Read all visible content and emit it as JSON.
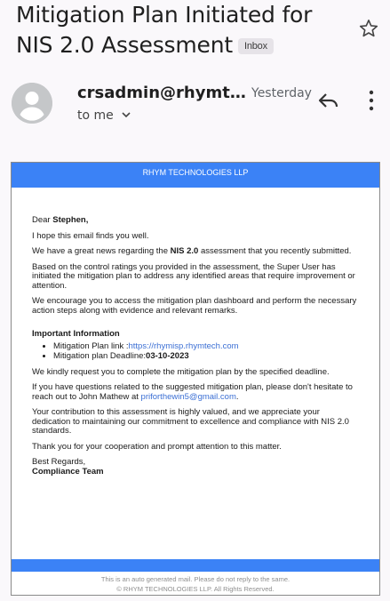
{
  "email": {
    "subject": "Mitigation Plan Initiated for NIS 2.0 Assessment",
    "label": "Inbox",
    "sender": "crsadmin@rhymtec...",
    "date": "Yesterday",
    "recipient": "to me"
  },
  "icons": {
    "star": "star-outline-icon",
    "avatar": "person-icon",
    "reply": "reply-icon",
    "more": "more-vert-icon",
    "expand": "chevron-down-icon"
  },
  "body": {
    "header": "RHYM TECHNOLOGIES LLP",
    "greeting_prefix": "Dear ",
    "greeting_name": "Stephen,",
    "p1": "I hope this email finds you well.",
    "p2_pre": "We have a great news regarding the ",
    "p2_bold": "NIS 2.0",
    "p2_post": " assessment that you recently submitted.",
    "p3": "Based on the control ratings you provided in the assessment, the Super User has initiated the mitigation plan to address any identified areas that require improvement or attention.",
    "p4": "We encourage you to access the mitigation plan dashboard and perform the necessary action steps along with evidence and relevant remarks.",
    "info_title": "Important Information",
    "link_label": "Mitigation Plan link :",
    "link_url": "https://rhymisp.rhymtech.com",
    "deadline_label": "Mitigation plan Deadline:",
    "deadline_value": "03-10-2023",
    "p5": "We kindly request you to complete the mitigation plan by the specified deadline.",
    "p6_pre": "If you have questions related to the suggested mitigation plan, please don't hesitate to reach out to John Mathew at ",
    "p6_email": "priforthewin5@gmail.com",
    "p6_post": ".",
    "p7": "Your contribution to this assessment is highly valued, and we appreciate your dedication to maintaining our commitment to excellence and compliance with NIS 2.0 standards.",
    "p8": "Thank you for your cooperation and prompt attention to this matter.",
    "signoff": "Best Regards,",
    "team": "Compliance Team",
    "footer1": "This is an auto generated mail. Please do not reply to the same.",
    "footer2": "© RHYM TECHNOLOGIES LLP. All Rights Reserved."
  },
  "colors": {
    "accent": "#3b82f6",
    "link": "#3b6fd4"
  }
}
